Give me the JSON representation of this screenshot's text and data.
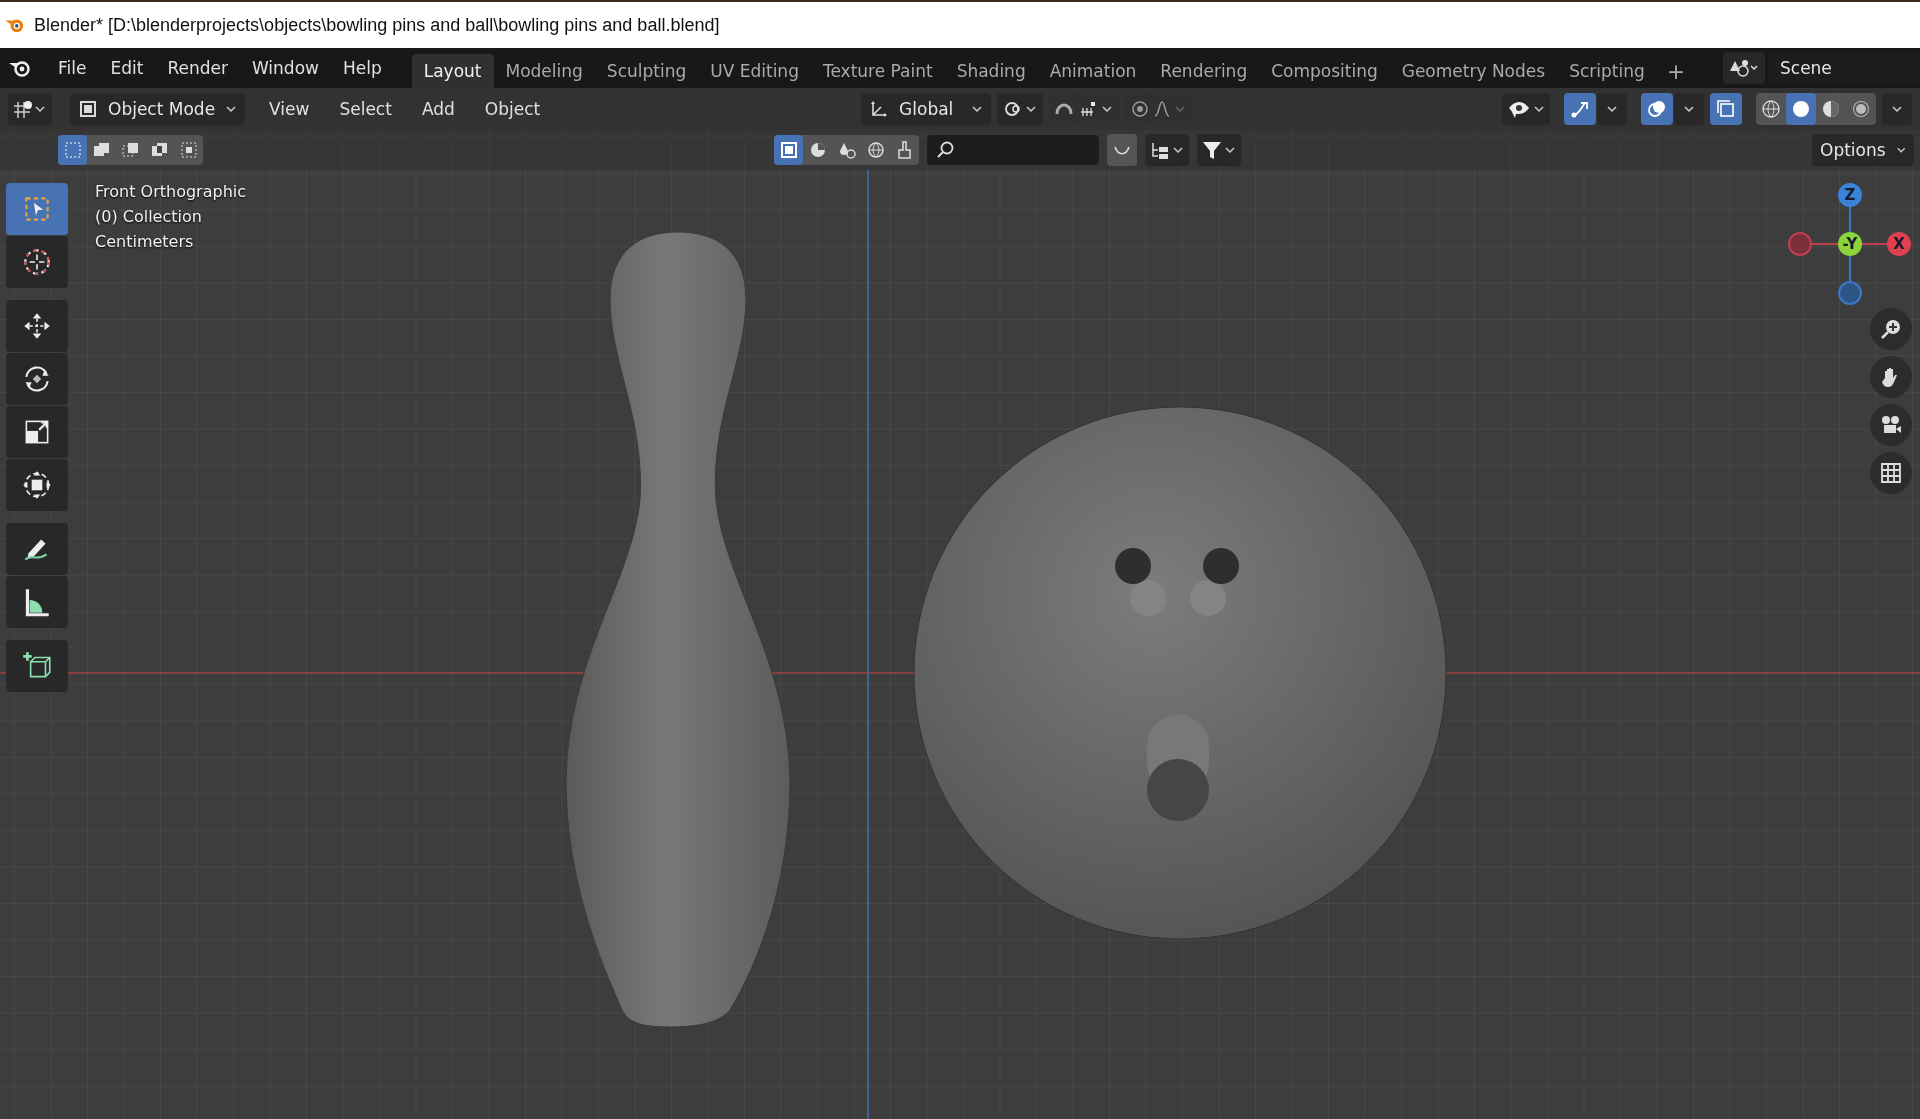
{
  "window": {
    "title": "Blender* [D:\\blenderprojects\\objects\\bowling pins and ball\\bowling pins and ball.blend]"
  },
  "menu": [
    "File",
    "Edit",
    "Render",
    "Window",
    "Help"
  ],
  "workspaces": [
    {
      "label": "Layout",
      "selected": true
    },
    {
      "label": "Modeling",
      "selected": false
    },
    {
      "label": "Sculpting",
      "selected": false
    },
    {
      "label": "UV Editing",
      "selected": false
    },
    {
      "label": "Texture Paint",
      "selected": false
    },
    {
      "label": "Shading",
      "selected": false
    },
    {
      "label": "Animation",
      "selected": false
    },
    {
      "label": "Rendering",
      "selected": false
    },
    {
      "label": "Compositing",
      "selected": false
    },
    {
      "label": "Geometry Nodes",
      "selected": false
    },
    {
      "label": "Scripting",
      "selected": false
    }
  ],
  "add_workspace": "+",
  "scene": "Scene",
  "header": {
    "mode": "Object Mode",
    "menus": [
      "View",
      "Select",
      "Add",
      "Object"
    ],
    "orientation": "Global",
    "snap": {
      "on": false
    },
    "proportional_editing": {
      "on": false
    },
    "gizmos": {
      "on": true
    },
    "overlays": {
      "on": true
    },
    "xray": {
      "on": true
    },
    "shading": [
      {
        "selected": false
      },
      {
        "selected": true
      },
      {
        "selected": false
      },
      {
        "selected": false
      }
    ]
  },
  "tool_settings": {
    "select_modes": [
      {
        "selected": true
      },
      {
        "selected": false
      },
      {
        "selected": false
      },
      {
        "selected": false
      },
      {
        "selected": false
      }
    ],
    "filters": [
      {
        "selected": true
      },
      {
        "selected": false
      },
      {
        "selected": false
      },
      {
        "selected": false
      },
      {
        "selected": false
      }
    ],
    "options": "Options"
  },
  "viewport": {
    "info": [
      "Front Orthographic",
      "(0) Collection",
      "Centimeters"
    ],
    "tools": [
      {
        "selected": true
      },
      {
        "selected": false
      },
      {
        "selected": false
      },
      {
        "selected": false
      },
      {
        "selected": false
      },
      {
        "selected": false
      },
      {
        "selected": false
      },
      {
        "selected": false
      },
      {
        "selected": false
      }
    ],
    "gizmo": {
      "z": "Z",
      "y": "-Y",
      "x": "X"
    }
  }
}
